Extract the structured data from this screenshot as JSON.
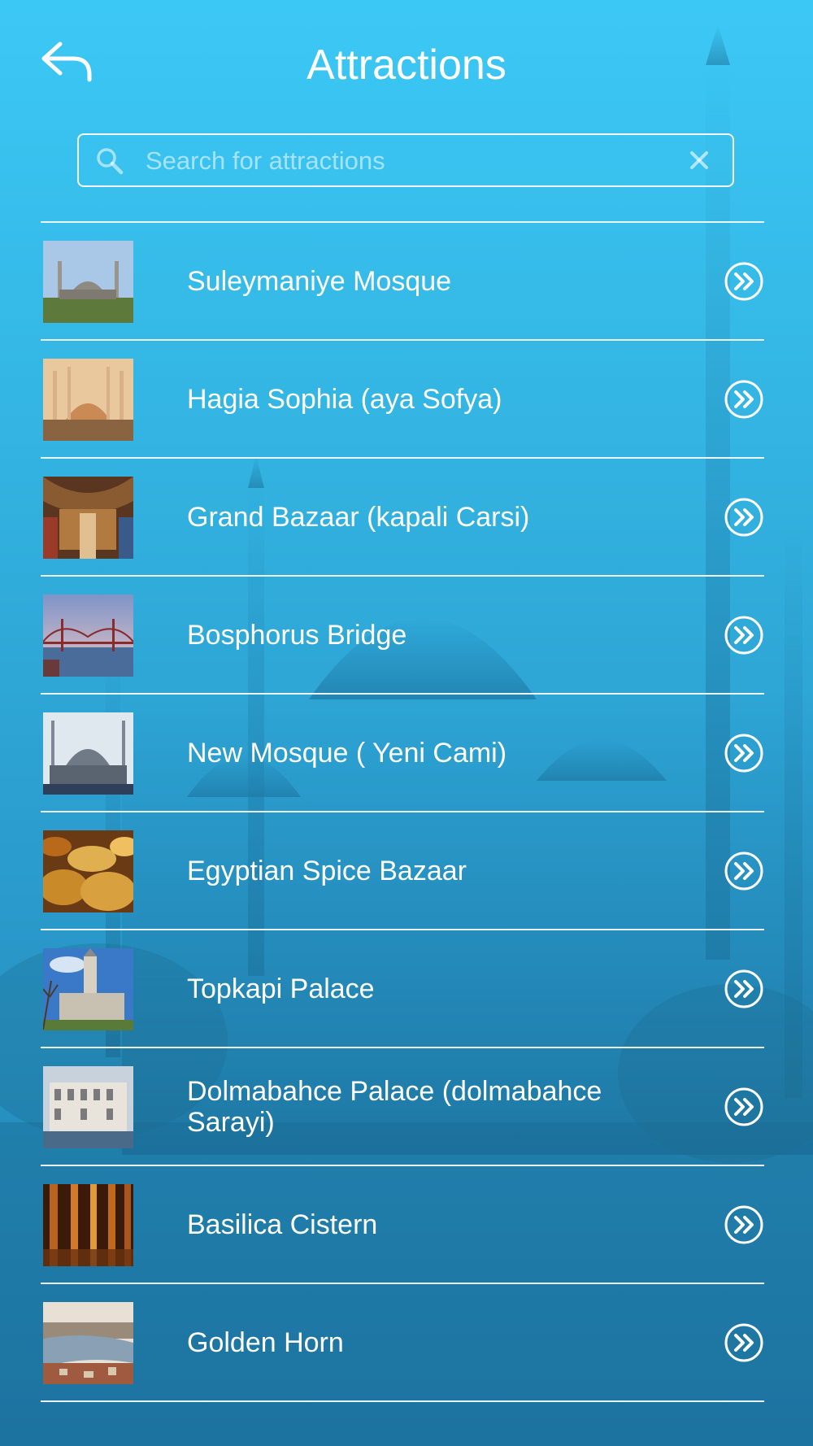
{
  "header": {
    "title": "Attractions",
    "back_icon": "reply-arrow-icon"
  },
  "search": {
    "placeholder": "Search for attractions",
    "value": "",
    "search_icon": "magnifier-icon",
    "clear_icon": "close-x-icon"
  },
  "attractions": [
    {
      "name": "Suleymaniye Mosque",
      "thumb": "mosque-photo"
    },
    {
      "name": "Hagia Sophia (aya Sofya)",
      "thumb": "hagia-sophia-photo"
    },
    {
      "name": "Grand Bazaar (kapali Carsi)",
      "thumb": "bazaar-photo"
    },
    {
      "name": "Bosphorus Bridge",
      "thumb": "bridge-photo"
    },
    {
      "name": "New Mosque ( Yeni Cami)",
      "thumb": "new-mosque-photo"
    },
    {
      "name": "Egyptian Spice Bazaar",
      "thumb": "spice-bazaar-photo"
    },
    {
      "name": "Topkapi Palace",
      "thumb": "palace-photo"
    },
    {
      "name": "Dolmabahce Palace (dolmabahce Sarayi)",
      "thumb": "dolmabahce-photo"
    },
    {
      "name": "Basilica Cistern",
      "thumb": "cistern-photo"
    },
    {
      "name": "Golden Horn",
      "thumb": "golden-horn-photo"
    }
  ],
  "colors": {
    "background_top": "#3cc8f5",
    "background_bottom": "#227fb0",
    "text": "#ffffff"
  }
}
